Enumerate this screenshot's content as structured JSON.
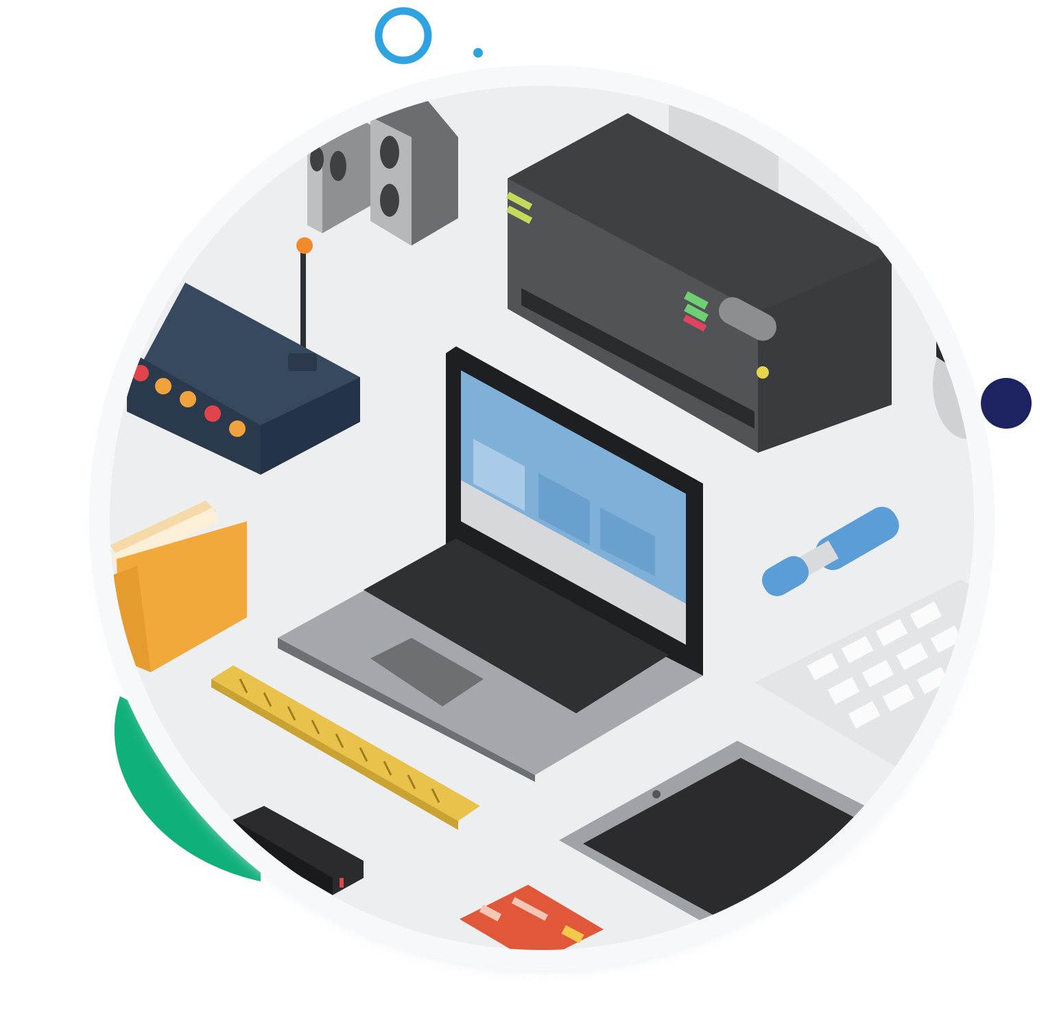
{
  "illustration": {
    "subject": "isometric-computer-hardware-collage",
    "colors": {
      "background": "#ffffff",
      "disc": "#eceef0",
      "disc_rim": "#f7f8f9",
      "ring_accent": "#2fa3e0",
      "dot_navy": "#1d2260",
      "green_blob": "#10b07a",
      "router_body": "#36495f",
      "router_led_red": "#e0454b",
      "router_led_orange": "#f0a33c",
      "printer_body": "#4b4c50",
      "laptop_shell": "#a4a7ab",
      "laptop_screen": "#7fb0d8",
      "folder": "#f2a93b",
      "ruler": "#e8c24a",
      "usb": "#5b9dd6",
      "keyboard": "#e4e5e7",
      "tablet": "#2b2b2d",
      "card": "#e0573a"
    },
    "icons": [
      "speakers-icon",
      "printer-icon",
      "router-icon",
      "laptop-icon",
      "folder-icon",
      "usb-drive-icon",
      "keyboard-icon",
      "ruler-icon",
      "tablet-icon",
      "hard-drive-icon",
      "credit-card-icon",
      "mouse-icon"
    ]
  }
}
